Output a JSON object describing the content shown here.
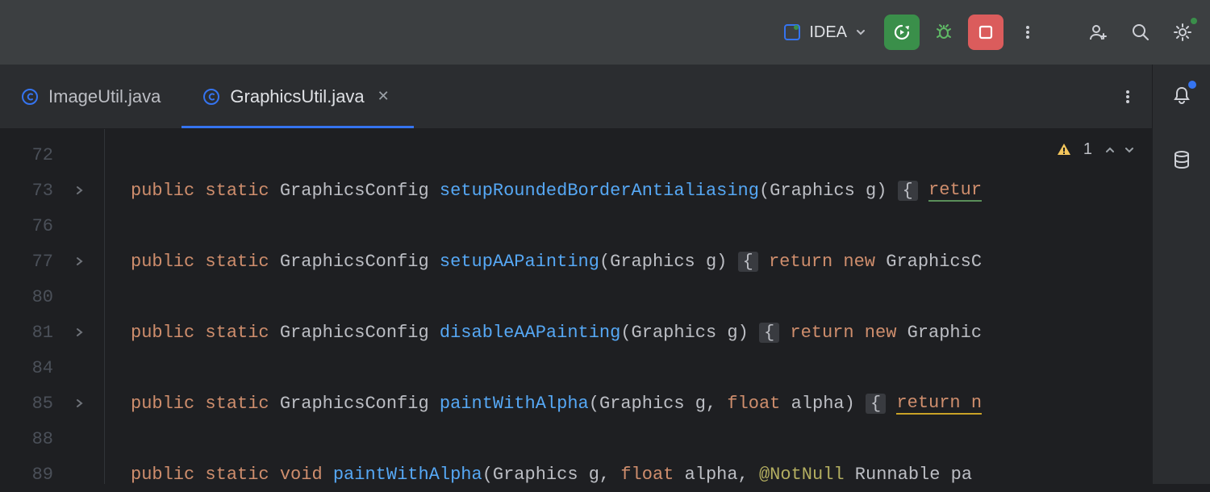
{
  "toolbar": {
    "run_target": "IDEA"
  },
  "tabs": [
    {
      "name": "ImageUtil.java",
      "active": false
    },
    {
      "name": "GraphicsUtil.java",
      "active": true
    }
  ],
  "inspection": {
    "warning_count": "1"
  },
  "lines": [
    {
      "num": "72",
      "fold": false,
      "tokens": []
    },
    {
      "num": "73",
      "fold": true,
      "tokens": [
        {
          "t": "public ",
          "c": "kw"
        },
        {
          "t": "static ",
          "c": "kw"
        },
        {
          "t": "GraphicsConfig ",
          "c": "type"
        },
        {
          "t": "setupRoundedBorderAntialiasing",
          "c": "method"
        },
        {
          "t": "(",
          "c": "punc"
        },
        {
          "t": "Graphics g",
          "c": "param"
        },
        {
          "t": ") ",
          "c": "punc"
        },
        {
          "t": "{",
          "c": "fold-brace"
        },
        {
          "t": " ",
          "c": "punc"
        },
        {
          "t": "retur",
          "c": "kw ul-green"
        }
      ]
    },
    {
      "num": "76",
      "fold": false,
      "tokens": []
    },
    {
      "num": "77",
      "fold": true,
      "tokens": [
        {
          "t": "public ",
          "c": "kw"
        },
        {
          "t": "static ",
          "c": "kw"
        },
        {
          "t": "GraphicsConfig ",
          "c": "type"
        },
        {
          "t": "setupAAPainting",
          "c": "method"
        },
        {
          "t": "(",
          "c": "punc"
        },
        {
          "t": "Graphics g",
          "c": "param"
        },
        {
          "t": ") ",
          "c": "punc"
        },
        {
          "t": "{",
          "c": "fold-brace"
        },
        {
          "t": " ",
          "c": "punc"
        },
        {
          "t": "return ",
          "c": "kw"
        },
        {
          "t": "new ",
          "c": "kw"
        },
        {
          "t": "GraphicsC",
          "c": "type"
        }
      ]
    },
    {
      "num": "80",
      "fold": false,
      "tokens": []
    },
    {
      "num": "81",
      "fold": true,
      "tokens": [
        {
          "t": "public ",
          "c": "kw"
        },
        {
          "t": "static ",
          "c": "kw"
        },
        {
          "t": "GraphicsConfig ",
          "c": "type"
        },
        {
          "t": "disableAAPainting",
          "c": "method"
        },
        {
          "t": "(",
          "c": "punc"
        },
        {
          "t": "Graphics g",
          "c": "param"
        },
        {
          "t": ") ",
          "c": "punc"
        },
        {
          "t": "{",
          "c": "fold-brace"
        },
        {
          "t": " ",
          "c": "punc"
        },
        {
          "t": "return ",
          "c": "kw"
        },
        {
          "t": "new ",
          "c": "kw"
        },
        {
          "t": "Graphic",
          "c": "type"
        }
      ]
    },
    {
      "num": "84",
      "fold": false,
      "tokens": []
    },
    {
      "num": "85",
      "fold": true,
      "tokens": [
        {
          "t": "public ",
          "c": "kw"
        },
        {
          "t": "static ",
          "c": "kw"
        },
        {
          "t": "GraphicsConfig ",
          "c": "type"
        },
        {
          "t": "paintWithAlpha",
          "c": "method"
        },
        {
          "t": "(",
          "c": "punc"
        },
        {
          "t": "Graphics g, ",
          "c": "param"
        },
        {
          "t": "float ",
          "c": "kw"
        },
        {
          "t": "alpha",
          "c": "param"
        },
        {
          "t": ") ",
          "c": "punc"
        },
        {
          "t": "{",
          "c": "fold-brace"
        },
        {
          "t": " ",
          "c": "punc"
        },
        {
          "t": "return n",
          "c": "kw ul-yellow"
        }
      ]
    },
    {
      "num": "88",
      "fold": false,
      "tokens": []
    },
    {
      "num": "89",
      "fold": false,
      "tokens": [
        {
          "t": "public ",
          "c": "kw"
        },
        {
          "t": "static ",
          "c": "kw"
        },
        {
          "t": "void ",
          "c": "kw"
        },
        {
          "t": "paintWithAlpha",
          "c": "method"
        },
        {
          "t": "(",
          "c": "punc"
        },
        {
          "t": "Graphics g, ",
          "c": "param"
        },
        {
          "t": "float ",
          "c": "kw"
        },
        {
          "t": "alpha, ",
          "c": "param"
        },
        {
          "t": "@NotNull",
          "c": "ann"
        },
        {
          "t": " Runnable pa",
          "c": "param"
        }
      ]
    }
  ]
}
